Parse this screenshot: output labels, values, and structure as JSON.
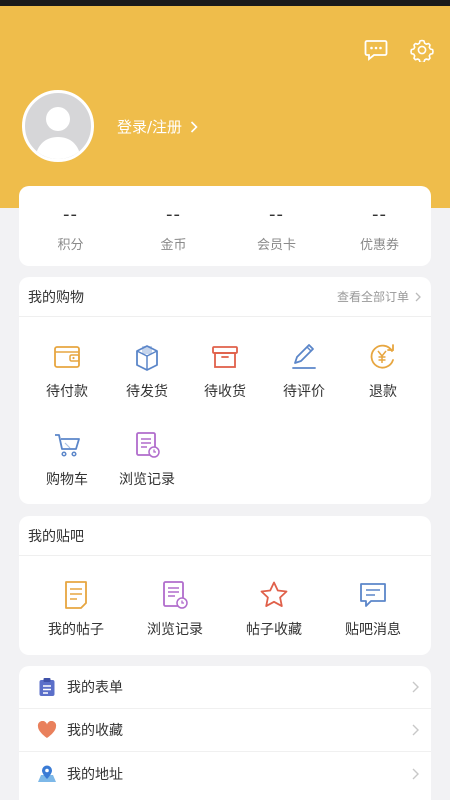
{
  "header": {
    "login_label": "登录/注册"
  },
  "stats": [
    {
      "value": "--",
      "label": "积分"
    },
    {
      "value": "--",
      "label": "金币"
    },
    {
      "value": "--",
      "label": "会员卡"
    },
    {
      "value": "--",
      "label": "优惠券"
    }
  ],
  "shopping": {
    "title": "我的购物",
    "view_all": "查看全部订单",
    "items": [
      {
        "label": "待付款",
        "icon": "wallet-icon"
      },
      {
        "label": "待发货",
        "icon": "package-icon"
      },
      {
        "label": "待收货",
        "icon": "box-icon"
      },
      {
        "label": "待评价",
        "icon": "pen-icon"
      },
      {
        "label": "退款",
        "icon": "yen-refund-icon"
      },
      {
        "label": "购物车",
        "icon": "cart-icon"
      },
      {
        "label": "浏览记录",
        "icon": "history-doc-icon"
      }
    ]
  },
  "tieba": {
    "title": "我的贴吧",
    "items": [
      {
        "label": "我的帖子",
        "icon": "note-icon"
      },
      {
        "label": "浏览记录",
        "icon": "history-doc-icon"
      },
      {
        "label": "帖子收藏",
        "icon": "star-icon"
      },
      {
        "label": "贴吧消息",
        "icon": "message-icon"
      }
    ]
  },
  "list": [
    {
      "label": "我的表单",
      "icon": "clipboard-icon"
    },
    {
      "label": "我的收藏",
      "icon": "heart-icon"
    },
    {
      "label": "我的地址",
      "icon": "location-icon"
    }
  ],
  "colors": {
    "header_bg": "#efbd4b",
    "orange": "#e7a640",
    "blue": "#5b86c9",
    "red": "#e0604a",
    "purple": "#b06ccc"
  }
}
